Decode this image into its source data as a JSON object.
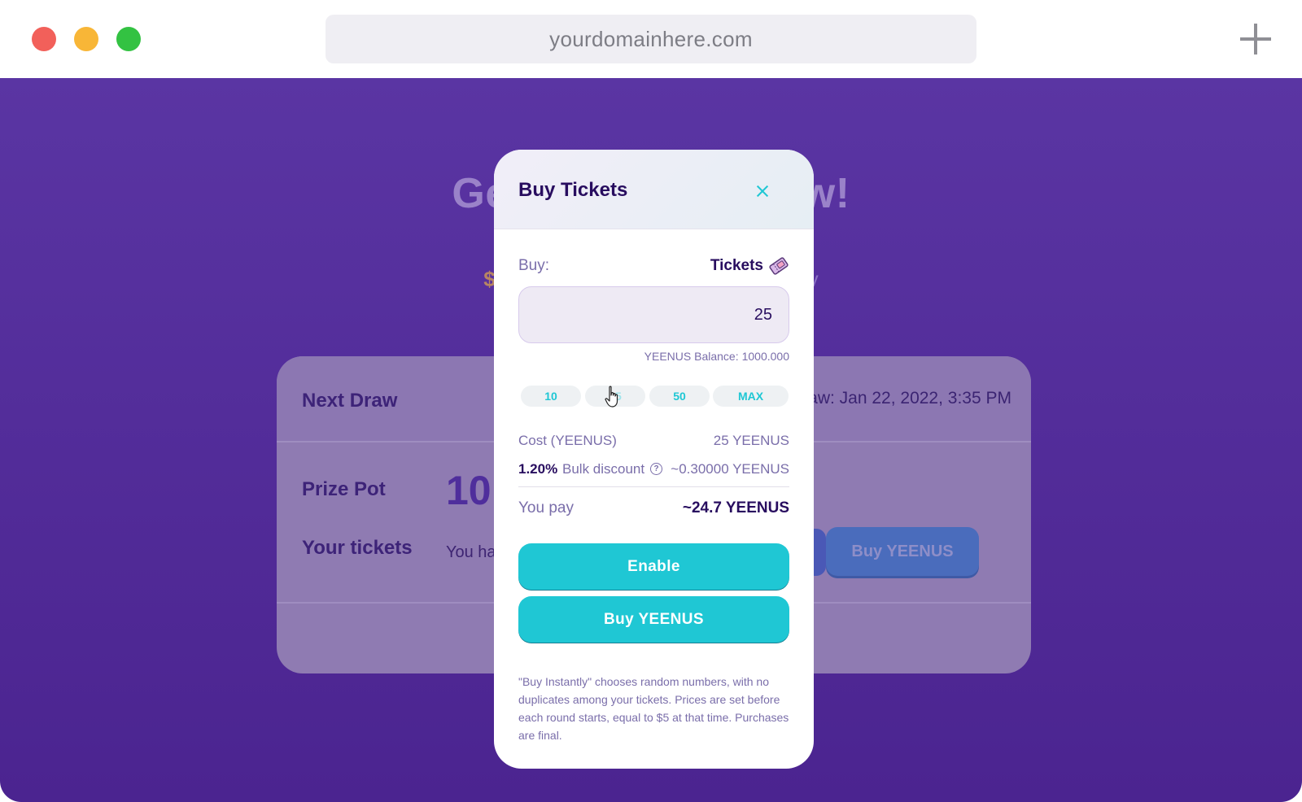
{
  "browser": {
    "url": "yourdomainhere.com"
  },
  "background_page": {
    "hero_title": "Ge                                   w!",
    "hero_title_left": "Ge",
    "hero_title_right": "w!",
    "hero_sub_left": "$",
    "hero_sub_right": "v",
    "next_draw_label": "Next Draw",
    "draw_time": "raw: Jan 22, 2022, 3:35 PM",
    "prize_pot_label": "Prize Pot",
    "prize_pot_value": "10",
    "your_tickets_label": "Your tickets",
    "you_have_text": "You ha",
    "buy_button_label": "Buy YEENUS"
  },
  "modal": {
    "title": "Buy Tickets",
    "buy_label": "Buy:",
    "tickets_label": "Tickets",
    "quantity_value": "25",
    "balance_label": "YEENUS Balance:",
    "balance_value": "1000.000",
    "quick_buttons": [
      "10",
      "25",
      "50",
      "MAX"
    ],
    "cost_label": "Cost (YEENUS)",
    "cost_value": "25 YEENUS",
    "discount_percent": "1.20%",
    "discount_label": "Bulk discount",
    "discount_value": "~0.30000 YEENUS",
    "pay_label": "You pay",
    "pay_value": "~24.7 YEENUS",
    "enable_label": "Enable",
    "buy_label_button": "Buy YEENUS",
    "note": "\"Buy Instantly\" chooses random numbers, with no duplicates among your tickets. Prices are set before each round starts, equal to $5 at that time. Purchases are final."
  },
  "colors": {
    "accent": "#1fc7d4",
    "text_primary": "#280d5f",
    "text_secondary": "#7a6eaa",
    "page_bg": "#5a35a3"
  }
}
